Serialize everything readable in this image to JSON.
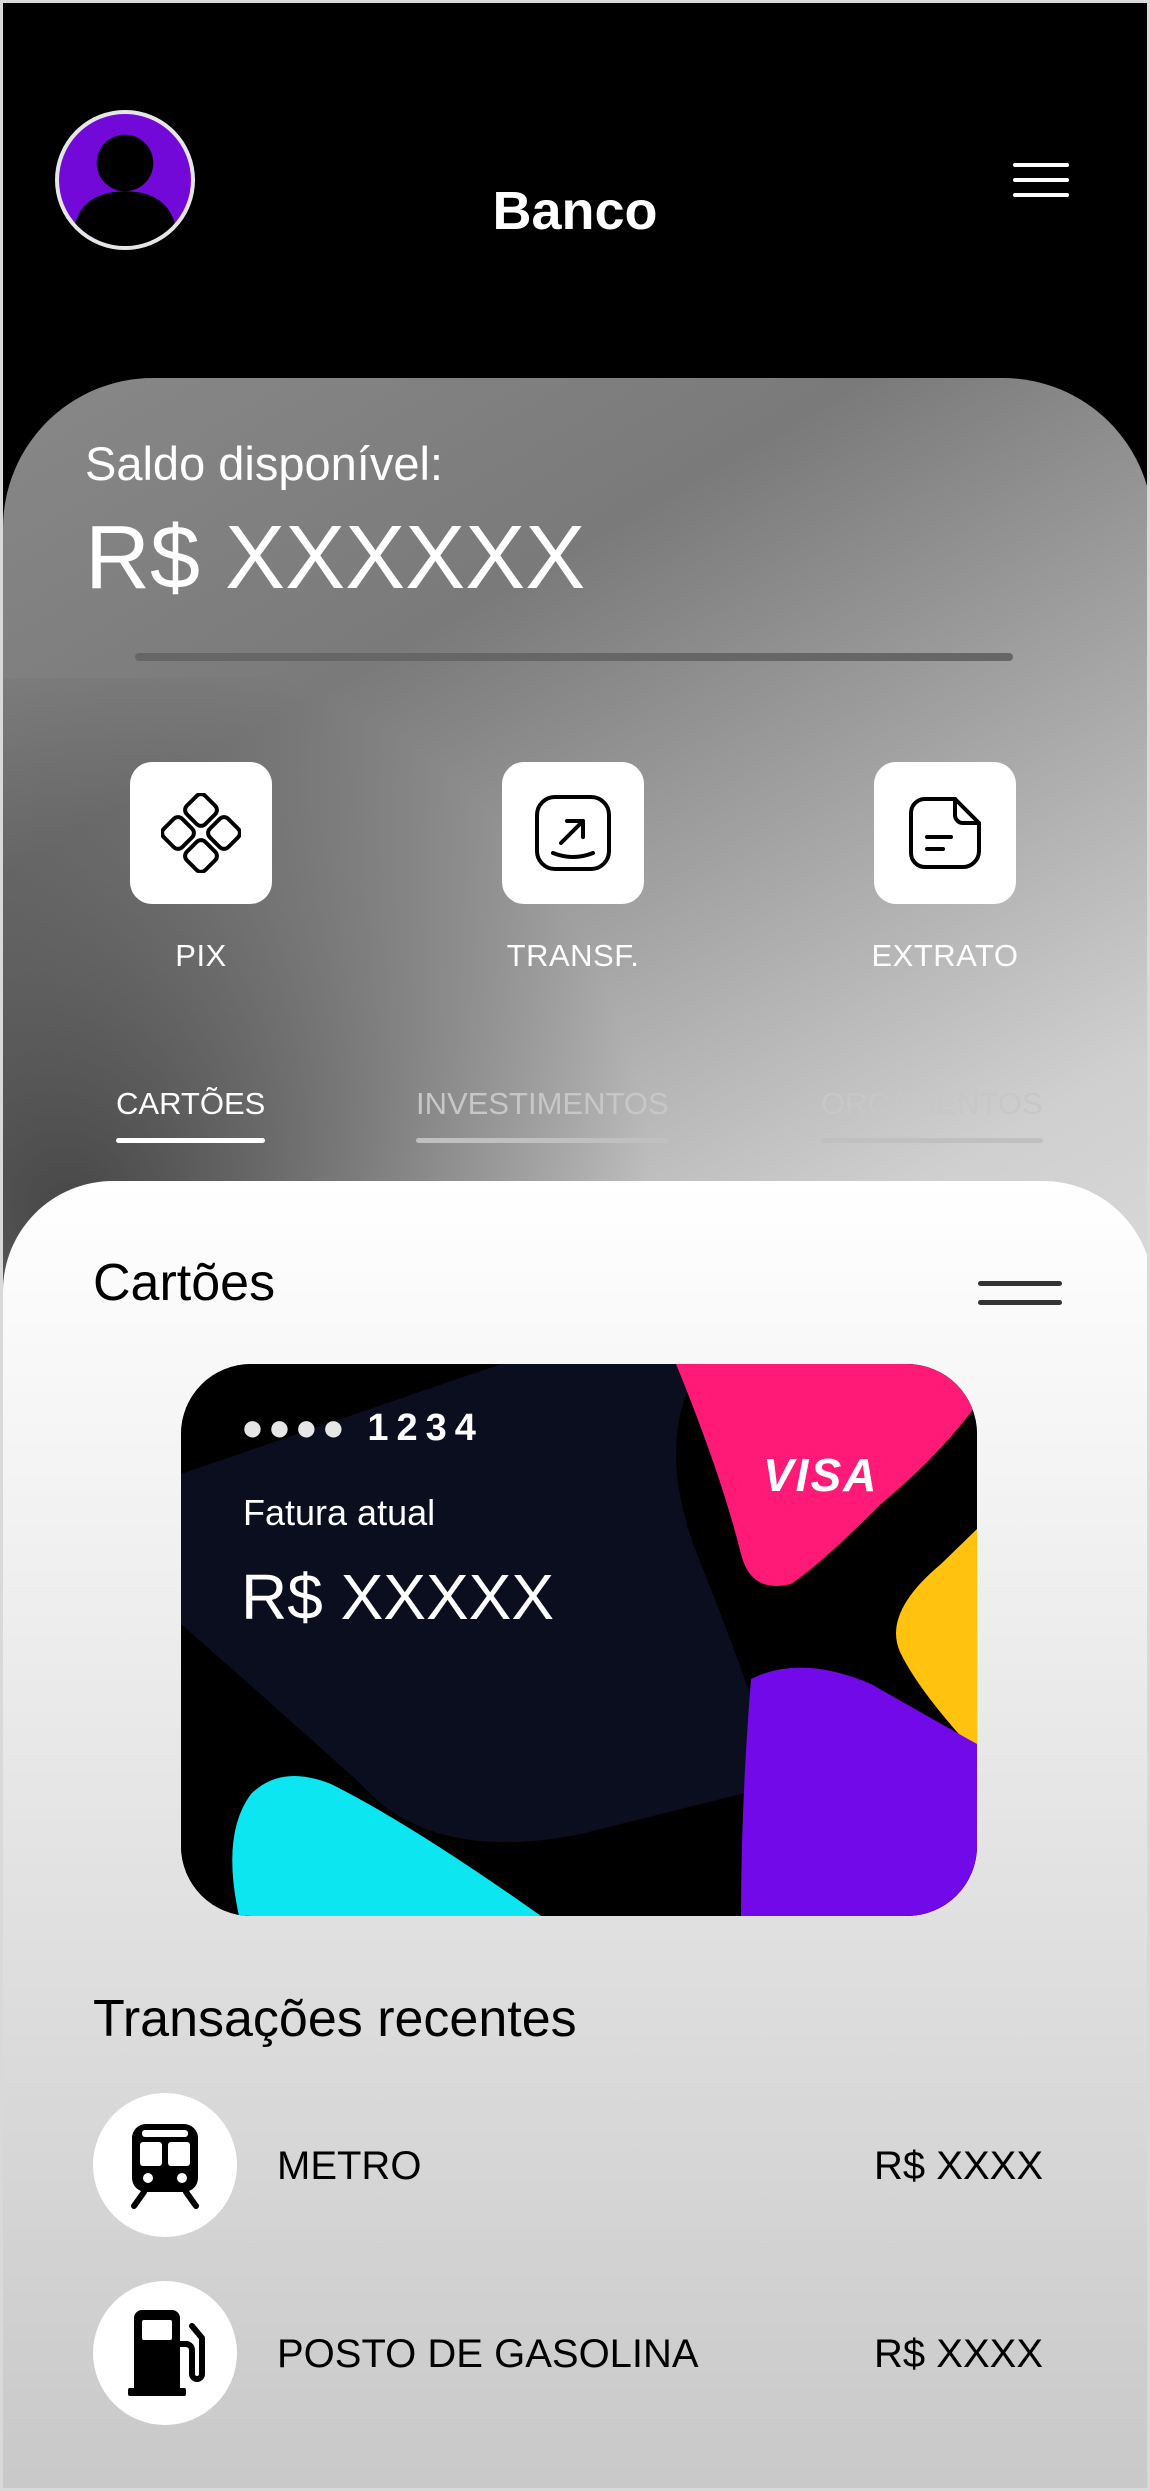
{
  "header": {
    "title": "Banco",
    "avatar_icon": "user-avatar-icon",
    "menu_icon": "hamburger-menu-icon",
    "accent_color": "#7209d8"
  },
  "balance": {
    "label": "Saldo disponível:",
    "value": "R$ XXXXXX"
  },
  "actions": [
    {
      "label": "PIX",
      "icon": "pix-icon"
    },
    {
      "label": "TRANSF.",
      "icon": "transfer-icon"
    },
    {
      "label": "EXTRATO",
      "icon": "statement-icon"
    }
  ],
  "tabs": [
    {
      "label": "CARTÕES",
      "active": true
    },
    {
      "label": "INVESTIMENTOS",
      "active": false
    },
    {
      "label": "ORÇAMENTOS",
      "active": false
    }
  ],
  "cards_section": {
    "title": "Cartões",
    "card": {
      "number_mask": "●●●●",
      "last_digits": "1234",
      "invoice_label": "Fatura atual",
      "invoice_value": "R$ XXXXX",
      "brand": "VISA",
      "colors": [
        "#ff1a78",
        "#ffc20e",
        "#7209e8",
        "#0be6f0",
        "#0b0e1f"
      ]
    }
  },
  "transactions": {
    "title": "Transações recentes",
    "items": [
      {
        "name": "METRO",
        "amount": "R$ XXXX",
        "icon": "train-icon"
      },
      {
        "name": "POSTO DE GASOLINA",
        "amount": "R$ XXXX",
        "icon": "gas-pump-icon"
      }
    ]
  }
}
